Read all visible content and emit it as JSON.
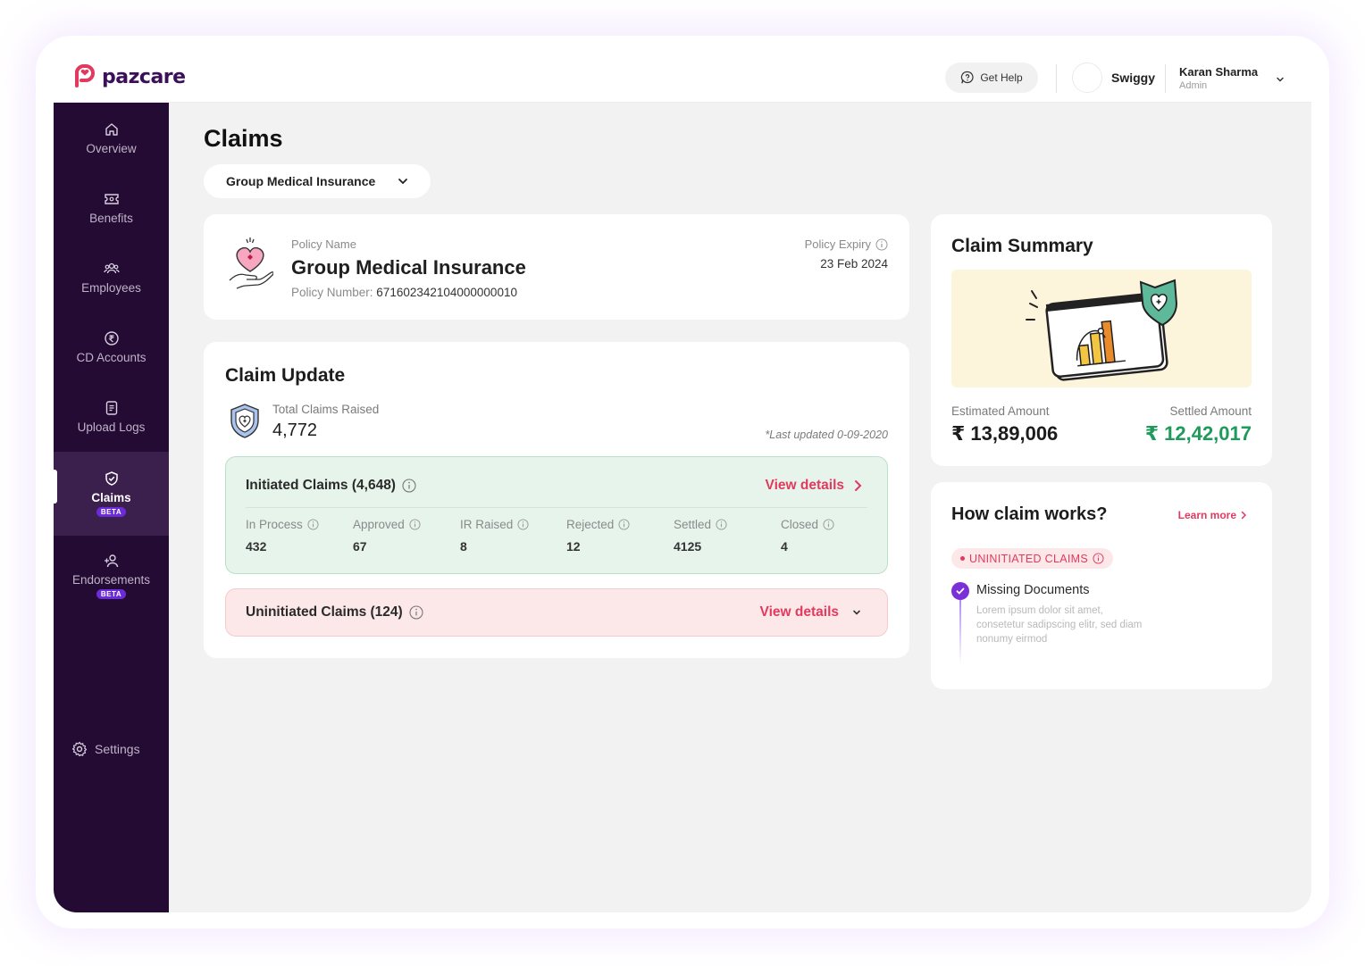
{
  "brand": {
    "name": "pazcare",
    "accent": "#e23a5e",
    "primary": "#240b33"
  },
  "header": {
    "help_label": "Get Help",
    "company": "Swiggy",
    "user_name": "Karan Sharma",
    "user_role": "Admin"
  },
  "sidebar": {
    "items": [
      {
        "label": "Overview",
        "icon": "home-icon"
      },
      {
        "label": "Benefits",
        "icon": "ticket-icon"
      },
      {
        "label": "Employees",
        "icon": "users-icon"
      },
      {
        "label": "CD Accounts",
        "icon": "rupee-coin-icon"
      },
      {
        "label": "Upload Logs",
        "icon": "document-icon"
      },
      {
        "label": "Claims",
        "icon": "shield-check-icon",
        "badge": "BETA",
        "active": true
      },
      {
        "label": "Endorsements",
        "icon": "user-add-icon",
        "badge": "BETA"
      }
    ],
    "settings_label": "Settings"
  },
  "page": {
    "title": "Claims",
    "policy_selector": "Group Medical Insurance"
  },
  "policy": {
    "name_label": "Policy Name",
    "name": "Group Medical Insurance",
    "number_label": "Policy Number:",
    "number": "671602342104000000010",
    "expiry_label": "Policy Expiry",
    "expiry": "23 Feb 2024"
  },
  "claim_update": {
    "title": "Claim Update",
    "total_label": "Total Claims Raised",
    "total": "4,772",
    "last_updated": "*Last updated 0-09-2020",
    "initiated": {
      "title": "Initiated Claims (4,648)",
      "view_label": "View details",
      "stats": [
        {
          "label": "In Process",
          "value": "432"
        },
        {
          "label": "Approved",
          "value": "67"
        },
        {
          "label": "IR Raised",
          "value": "8"
        },
        {
          "label": "Rejected",
          "value": "12"
        },
        {
          "label": "Settled",
          "value": "4125"
        },
        {
          "label": "Closed",
          "value": "4"
        }
      ]
    },
    "uninitiated": {
      "title": "Uninitiated Claims (124)",
      "view_label": "View details"
    }
  },
  "summary": {
    "title": "Claim Summary",
    "estimated_label": "Estimated Amount",
    "estimated": "₹ 13,89,006",
    "settled_label": "Settled Amount",
    "settled": "₹ 12,42,017"
  },
  "how_it_works": {
    "title": "How claim works?",
    "learn_more": "Learn more",
    "badge": "UNINITIATED CLAIMS",
    "step_title": "Missing Documents",
    "step_desc": "Lorem ipsum dolor sit amet, consetetur sadipscing elitr, sed diam nonumy eirmod"
  }
}
